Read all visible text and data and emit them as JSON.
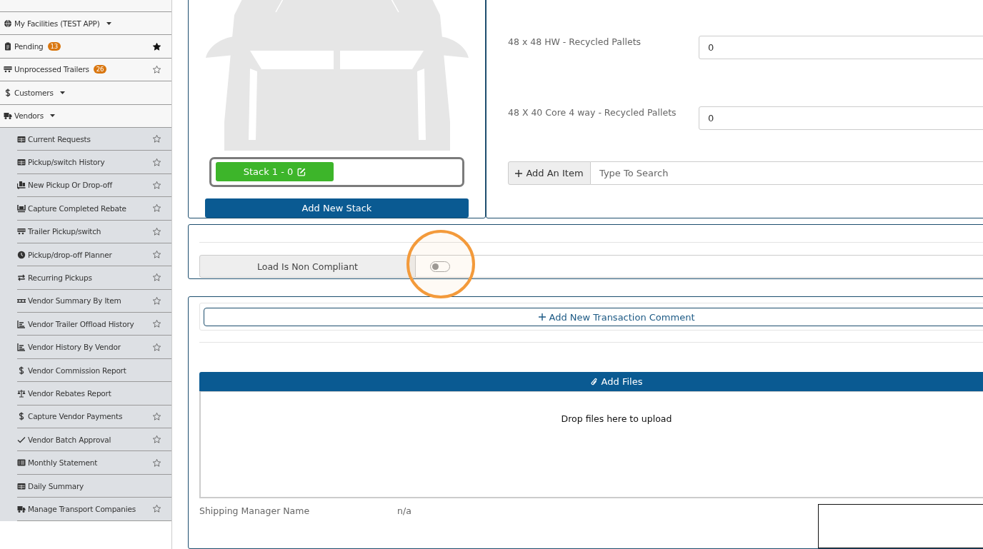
{
  "sidebar": {
    "items": [
      {
        "label": "My Facilities (TEST APP)",
        "kind": "dropdown"
      },
      {
        "label": "Pending",
        "badge": "13",
        "favorite": true
      },
      {
        "label": "Unprocessed Trailers",
        "badge": "26",
        "favorite": false
      },
      {
        "label": "Customers",
        "kind": "dropdown"
      },
      {
        "label": "Vendors",
        "kind": "dropdown",
        "children": [
          {
            "label": "Current Requests",
            "favorite": false
          },
          {
            "label": "Pickup/switch History",
            "favorite": false
          },
          {
            "label": "New Pickup Or Drop-off",
            "favorite": false
          },
          {
            "label": "Capture Completed Rebate",
            "favorite": false
          },
          {
            "label": "Trailer Pickup/switch",
            "favorite": false
          },
          {
            "label": "Pickup/drop-off Planner",
            "favorite": false
          },
          {
            "label": "Recurring Pickups",
            "favorite": false
          },
          {
            "label": "Vendor Summary By Item",
            "favorite": false
          },
          {
            "label": "Vendor Trailer Offload History",
            "favorite": false
          },
          {
            "label": "Vendor History By Vendor",
            "favorite": false
          },
          {
            "label": "Vendor Commission Report"
          },
          {
            "label": "Vendor Rebates Report"
          },
          {
            "label": "Capture Vendor Payments",
            "favorite": false
          },
          {
            "label": "Vendor Batch Approval",
            "favorite": false
          },
          {
            "label": "Monthly Statement",
            "favorite": false
          },
          {
            "label": "Daily Summary"
          },
          {
            "label": "Manage Transport Companies",
            "favorite": false
          }
        ]
      }
    ]
  },
  "stack": {
    "stacks": [
      {
        "label": "Stack 1 - 0"
      }
    ],
    "add_button": "Add New Stack"
  },
  "items": {
    "rows": [
      {
        "label": "48 x 48 HW - Recycled Pallets",
        "value": "0"
      },
      {
        "label": "48 X 40 Core 4 way - Recycled Pallets",
        "value": "0"
      }
    ],
    "add_button": "Add An Item",
    "search_placeholder": "Type To Search"
  },
  "compliance": {
    "label": "Load Is Non Compliant",
    "on": false
  },
  "comments": {
    "add_button": "Add New Transaction Comment"
  },
  "files": {
    "add_button": "Add Files",
    "dropzone": "Drop files here to upload"
  },
  "shipping_manager": {
    "label": "Shipping Manager Name",
    "value": "n/a"
  }
}
